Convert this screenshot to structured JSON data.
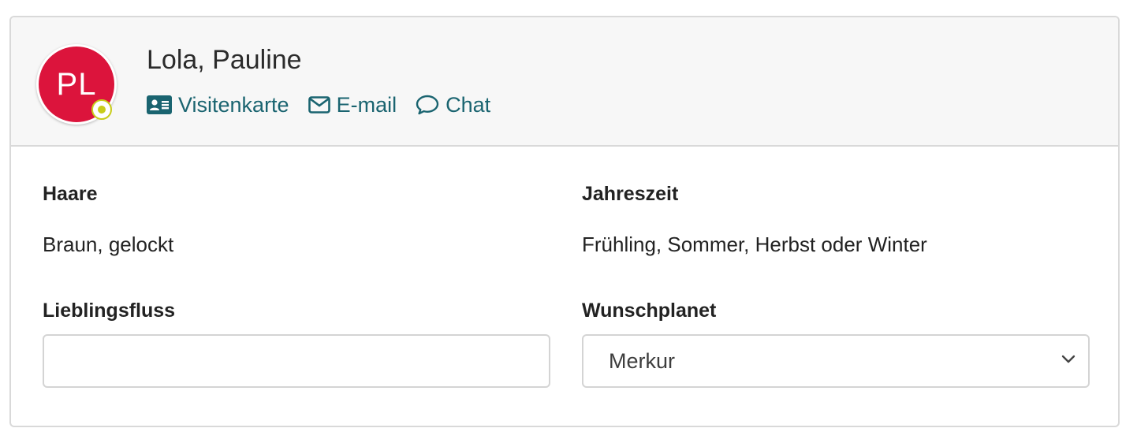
{
  "user": {
    "initials": "PL",
    "name": "Lola, Pauline",
    "avatar_color": "#dc143c",
    "status_color": "#c8cc1a"
  },
  "actions": [
    {
      "label": "Visitenkarte",
      "icon": "id-card-icon"
    },
    {
      "label": "E-mail",
      "icon": "envelope-icon"
    },
    {
      "label": "Chat",
      "icon": "chat-bubble-icon"
    }
  ],
  "fields": {
    "haare": {
      "label": "Haare",
      "value": "Braun, gelockt"
    },
    "jahreszeit": {
      "label": "Jahreszeit",
      "value": "Frühling, Sommer, Herbst oder Winter"
    },
    "lieblingsfluss": {
      "label": "Lieblingsfluss",
      "value": "",
      "placeholder": ""
    },
    "wunschplanet": {
      "label": "Wunschplanet",
      "selected": "Merkur"
    }
  },
  "colors": {
    "link": "#1a6470",
    "header_bg": "#f7f7f7",
    "border": "#d9d9d9"
  }
}
